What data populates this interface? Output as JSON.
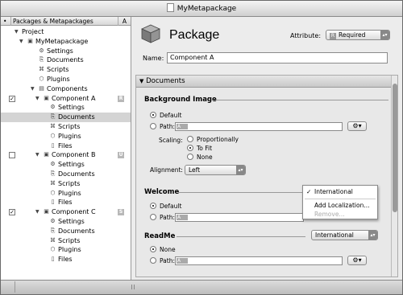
{
  "window": {
    "title": "MyMetapackage"
  },
  "sidebar": {
    "header": {
      "first_col": "Packages & Metapackages",
      "second_col": "A"
    },
    "items": [
      {
        "label": "Project"
      },
      {
        "label": "MyMetapackage"
      },
      {
        "label": "Settings"
      },
      {
        "label": "Documents"
      },
      {
        "label": "Scripts"
      },
      {
        "label": "Plugins"
      },
      {
        "label": "Components"
      },
      {
        "label": "Component A",
        "badge": "R"
      },
      {
        "label": "Settings"
      },
      {
        "label": "Documents"
      },
      {
        "label": "Scripts"
      },
      {
        "label": "Plugins"
      },
      {
        "label": "Files"
      },
      {
        "label": "Component B",
        "badge": "U"
      },
      {
        "label": "Settings"
      },
      {
        "label": "Documents"
      },
      {
        "label": "Scripts"
      },
      {
        "label": "Plugins"
      },
      {
        "label": "Files"
      },
      {
        "label": "Component C",
        "badge": "S"
      },
      {
        "label": "Settings"
      },
      {
        "label": "Documents"
      },
      {
        "label": "Scripts"
      },
      {
        "label": "Plugins"
      },
      {
        "label": "Files"
      }
    ]
  },
  "main": {
    "title": "Package",
    "attribute_label": "Attribute:",
    "attribute_tag": "R",
    "attribute_value": "Required",
    "name_label": "Name:",
    "name_value": "Component A",
    "section_bar": "Documents",
    "background": {
      "heading": "Background Image",
      "default": "Default",
      "path": "Path:",
      "path_tag": "A",
      "scaling_label": "Scaling:",
      "scaling": [
        "Proportionally",
        "To Fit",
        "None"
      ],
      "alignment_label": "Alignment:",
      "alignment_value": "Left"
    },
    "welcome": {
      "heading": "Welcome",
      "default": "Default",
      "path": "Path:",
      "path_tag": "A"
    },
    "readme": {
      "heading": "ReadMe",
      "localization": "International",
      "none": "None",
      "path": "Path:",
      "path_tag": "A"
    },
    "localization_menu": {
      "checked": "International",
      "add": "Add Localization...",
      "remove": "Remove..."
    }
  },
  "icons": {
    "gear": "gear-icon",
    "package": "package-icon"
  }
}
